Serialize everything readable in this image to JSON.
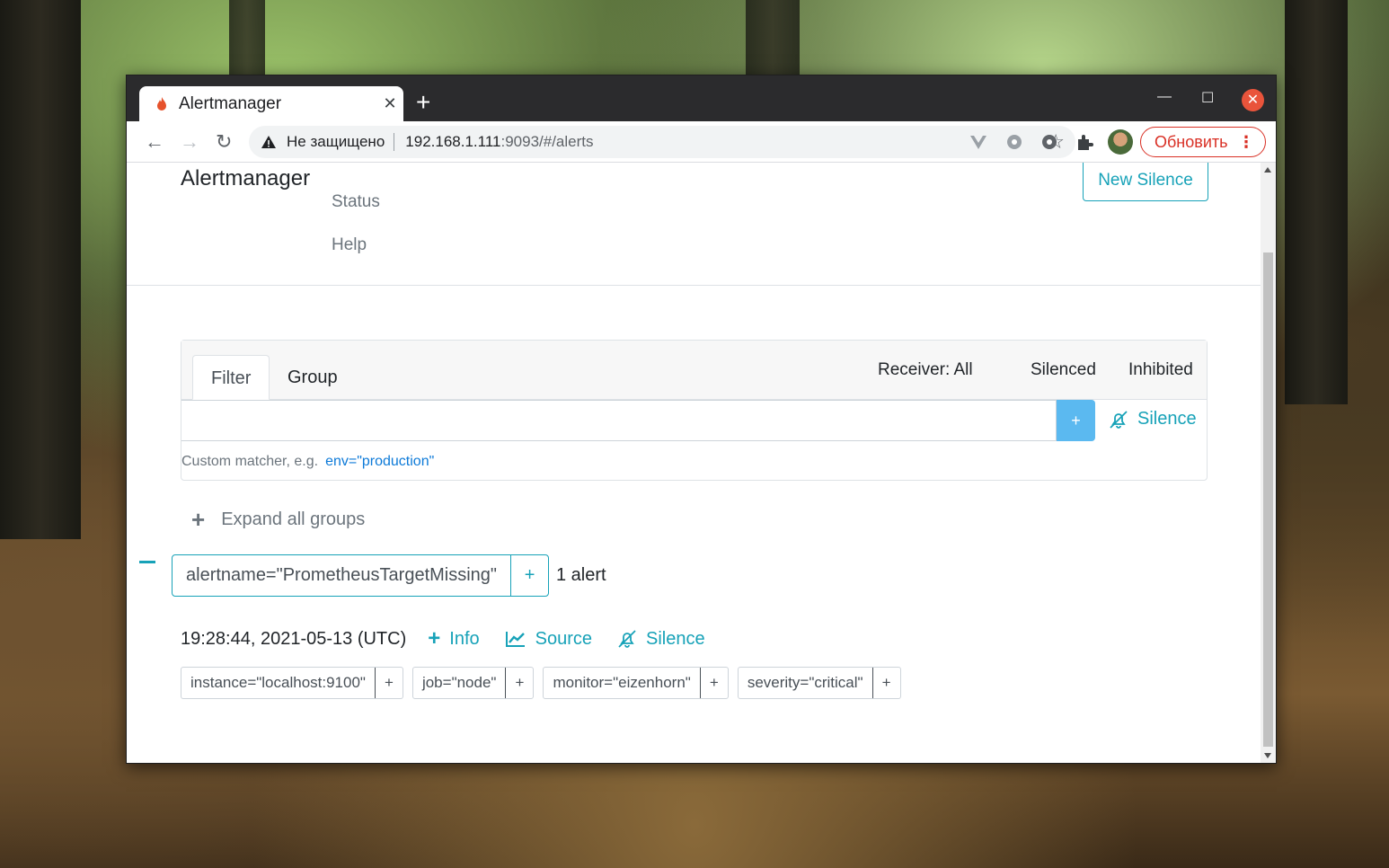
{
  "browser": {
    "tab_title": "Alertmanager",
    "insecure_label": "Не защищено",
    "url_host": "192.168.1.111",
    "url_rest": ":9093/#/alerts",
    "update_button": "Обновить"
  },
  "navbar": {
    "brand": "Alertmanager",
    "links": [
      "Status",
      "Help"
    ],
    "new_silence": "New Silence"
  },
  "filter_card": {
    "tabs": [
      "Filter",
      "Group"
    ],
    "receiver": "Receiver: All",
    "silenced": "Silenced",
    "inhibited": "Inhibited",
    "input_value": "",
    "add_button": "+",
    "silence_link": "Silence",
    "helper_text": "Custom matcher, e.g.",
    "helper_example": "env=\"production\""
  },
  "expand_all": "Expand all groups",
  "group": {
    "label": "alertname=\"PrometheusTargetMissing\"",
    "plus": "+",
    "count": "1 alert"
  },
  "alert": {
    "timestamp": "19:28:44, 2021-05-13 (UTC)",
    "actions": [
      "Info",
      "Source",
      "Silence"
    ],
    "labels": [
      "instance=\"localhost:9100\"",
      "job=\"node\"",
      "monitor=\"eizenhorn\"",
      "severity=\"critical\""
    ],
    "label_plus": "+"
  },
  "colors": {
    "accent": "#17a2b8",
    "primary_button": "#5bb9f0",
    "update_red": "#d93025"
  }
}
